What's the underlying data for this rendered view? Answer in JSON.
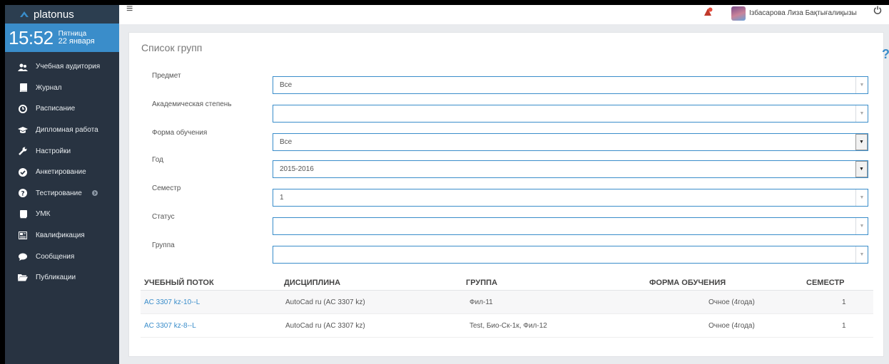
{
  "brand": {
    "name": "platonus"
  },
  "clock": {
    "time": "15:52",
    "day": "Пятница",
    "date": "22 января"
  },
  "sidebar": {
    "items": [
      {
        "label": "Учебная аудитория",
        "icon": "users-icon"
      },
      {
        "label": "Журнал",
        "icon": "book-icon"
      },
      {
        "label": "Расписание",
        "icon": "clock-icon"
      },
      {
        "label": "Дипломная работа",
        "icon": "graduation-cap-icon"
      },
      {
        "label": "Настройки",
        "icon": "wrench-icon"
      },
      {
        "label": "Анкетирование",
        "icon": "check-circle-icon"
      },
      {
        "label": "Тестирование",
        "icon": "question-circle-icon"
      },
      {
        "label": "УМК",
        "icon": "book-icon"
      },
      {
        "label": "Квалификация",
        "icon": "newspaper-icon"
      },
      {
        "label": "Сообщения",
        "icon": "comments-icon"
      },
      {
        "label": "Публикации",
        "icon": "folder-open-icon"
      }
    ]
  },
  "topbar": {
    "username": "Ізбасарова Лиза Бақтығалиқызы"
  },
  "page": {
    "title": "Список групп"
  },
  "filters": [
    {
      "label": "Предмет",
      "value": "Все"
    },
    {
      "label": "Академическая степень",
      "value": ""
    },
    {
      "label": "Форма обучения",
      "value": "Все"
    },
    {
      "label": "Год",
      "value": "2015-2016"
    },
    {
      "label": "Семестр",
      "value": "1"
    },
    {
      "label": "Статус",
      "value": ""
    },
    {
      "label": "Группа",
      "value": ""
    }
  ],
  "table": {
    "headers": [
      "УЧЕБНЫЙ ПОТОК",
      "ДИСЦИПЛИНА",
      "ГРУППА",
      "ФОРМА ОБУЧЕНИЯ",
      "СЕМЕСТР"
    ],
    "rows": [
      [
        "AC 3307 kz-10--L",
        "AutoCad ru (AC 3307 kz)",
        "Фил-11",
        "Очное (4года)",
        "1"
      ],
      [
        "AC 3307 kz-8--L",
        "AutoCad ru (AC 3307 kz)",
        "Test, Био-Ск-1к, Фил-12",
        "Очное (4года)",
        "1"
      ]
    ]
  },
  "colors": {
    "sidebar_bg": "#283341",
    "accent": "#3a8dca",
    "link": "#3a8dca",
    "notification": "#c0392b"
  }
}
